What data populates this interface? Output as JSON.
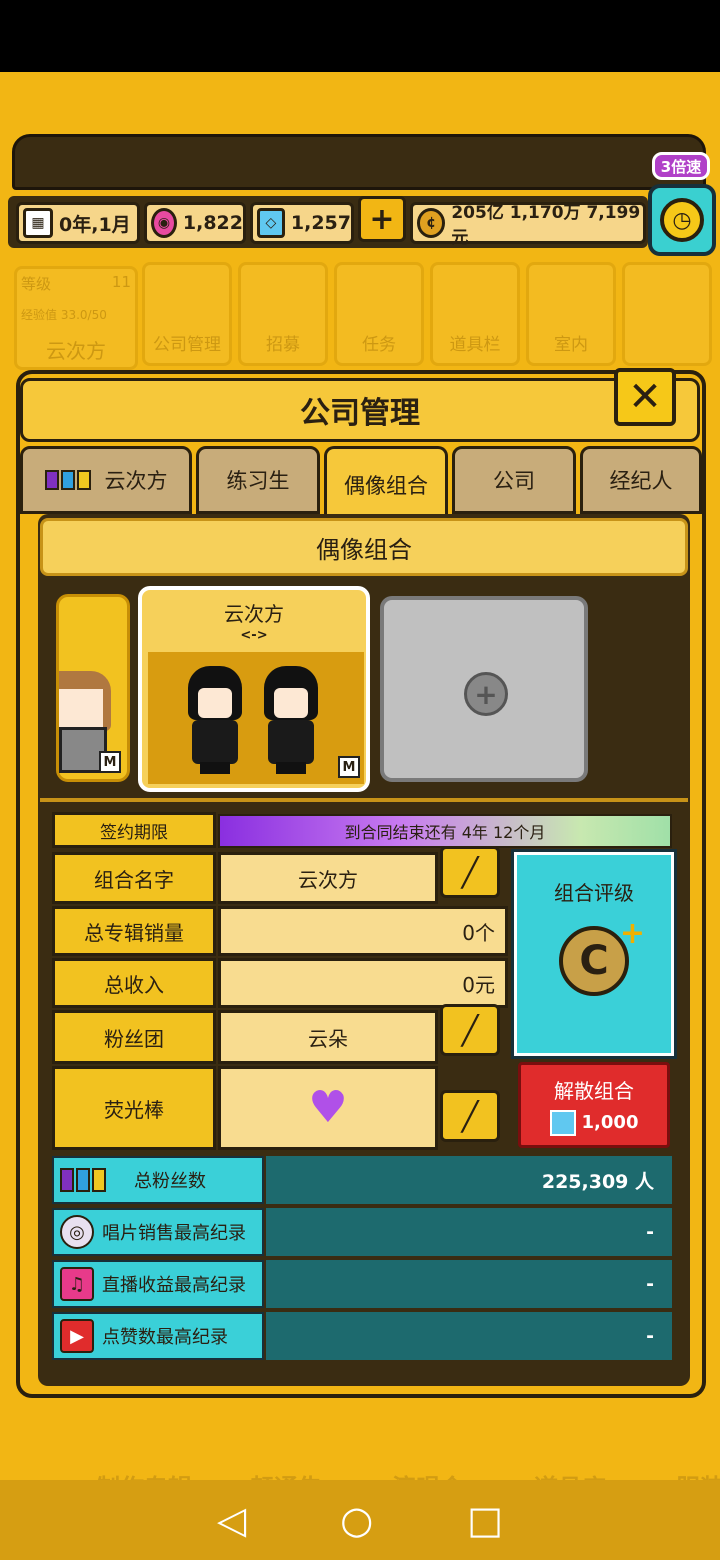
{
  "resources": {
    "date": "0年,1月",
    "gems": "1,822",
    "diamonds": "1,257",
    "plus": "+",
    "money": "205亿 1,170万 7,199元",
    "speed": "3倍速"
  },
  "background_menu": {
    "level_label": "等级",
    "level_value": "11",
    "exp_label": "经验值 33.0/50",
    "group_name": "云次方",
    "items": [
      "公司管理",
      "招募",
      "任务",
      "道具栏",
      "室内"
    ],
    "bottom": [
      "制作专辑",
      "赶通告",
      "演唱会",
      "道具店",
      "服装"
    ]
  },
  "panel": {
    "title": "公司管理",
    "close": "✕",
    "tabs": [
      "云次方",
      "练习生",
      "偶像组合",
      "公司",
      "经纪人"
    ],
    "active_tab": 2,
    "section_title": "偶像组合"
  },
  "groups": {
    "selected_name": "云次方",
    "selected_arrows": "<->",
    "gender_badge": "M",
    "add_symbol": "+"
  },
  "info": {
    "contract_label": "签约期限",
    "contract_text": "到合同结束还有 4年 12个月",
    "name_label": "组合名字",
    "name_value": "云次方",
    "album_label": "总专辑销量",
    "album_value": "0个",
    "income_label": "总收入",
    "income_value": "0元",
    "fanclub_label": "粉丝团",
    "fanclub_value": "云朵",
    "lightstick_label": "荧光棒",
    "rating_label": "组合评级",
    "disband_label": "解散组合",
    "disband_cost": "1,000"
  },
  "stats": [
    {
      "label": "总粉丝数",
      "value": "225,309 人",
      "icon": "fans-icon"
    },
    {
      "label": "唱片销售最高纪录",
      "value": "-",
      "icon": "disc-icon"
    },
    {
      "label": "直播收益最高纪录",
      "value": "-",
      "icon": "music-note-icon"
    },
    {
      "label": "点赞数最高纪录",
      "value": "-",
      "icon": "play-icon"
    }
  ],
  "colors": {
    "primary": "#f2b614",
    "teal": "#3ad0d8",
    "dark_teal": "#1d6a6e",
    "red": "#e02c2c",
    "purple": "#a040d8"
  }
}
